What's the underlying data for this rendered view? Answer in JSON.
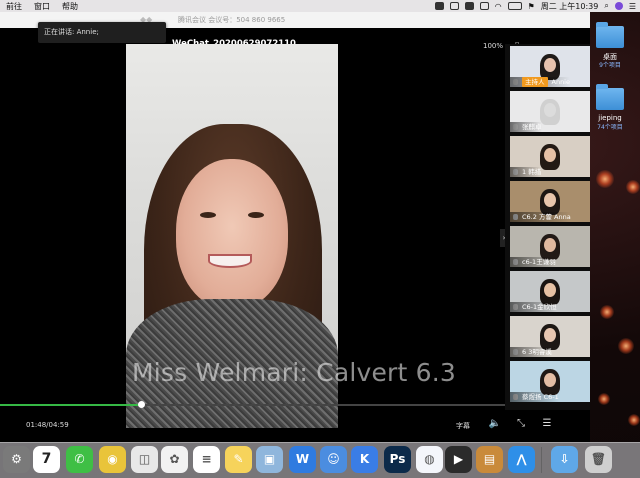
{
  "menubar": {
    "items": [
      "前往",
      "窗口",
      "帮助"
    ],
    "clock": "周二 上午10:39"
  },
  "meeting": {
    "id_text": "腾讯会议 会议号：504 860 9665",
    "speaking": "正在讲话: Annie;"
  },
  "player": {
    "title": "WeChat_20200629072110",
    "zoom": "100%",
    "caption": "Miss Welmari: Calvert 6.3",
    "time": "01:48/04:59",
    "subtitle_label": "字幕",
    "progress": 0.28
  },
  "participants": [
    {
      "name": "Annie",
      "host_tag": "主持人",
      "bg": "#dfe3ea",
      "skin": "#e7c2ae",
      "hair": "#1f1a18"
    },
    {
      "name": "张麒卓",
      "host_tag": "",
      "bg": "#e9e9ea",
      "skin": "#dcdcdc",
      "hair": "#d0d0d0"
    },
    {
      "name": "1 韩措",
      "host_tag": "",
      "bg": "#d8cfc4",
      "skin": "#e5c0a5",
      "hair": "#231a14"
    },
    {
      "name": "C6.2 方藿 Anna",
      "host_tag": "",
      "bg": "#a98e6c",
      "skin": "#e7c5ac",
      "hair": "#1d1714"
    },
    {
      "name": "c6-1王谦羽",
      "host_tag": "",
      "bg": "#b9b6ae",
      "skin": "#e0b99f",
      "hair": "#221a16"
    },
    {
      "name": "C6-1金欣恒",
      "host_tag": "",
      "bg": "#c5c8c9",
      "skin": "#e6c1a4",
      "hair": "#1a1512"
    },
    {
      "name": "6 3明睿溪",
      "host_tag": "",
      "bg": "#d9d4cd",
      "skin": "#e7c6b0",
      "hair": "#1c1714"
    },
    {
      "name": "蔡煜扬 C6-1",
      "host_tag": "",
      "bg": "#bcd6e4",
      "skin": "#e4bea4",
      "hair": "#201915"
    }
  ],
  "desktop": {
    "folders": [
      {
        "name": "桌面",
        "count": "9个项目"
      },
      {
        "name": "jieping",
        "count": "74个项目"
      }
    ]
  },
  "dock": {
    "calendar_day": "7",
    "apps": [
      {
        "name": "system-preferences",
        "color": "#7a7a7a",
        "glyph": "⚙"
      },
      {
        "name": "calendar",
        "color": "#ffffff",
        "glyph": ""
      },
      {
        "name": "wechat",
        "color": "#3fbf45",
        "glyph": "✆"
      },
      {
        "name": "chrome",
        "color": "#e9c43a",
        "glyph": "◉"
      },
      {
        "name": "screenshot",
        "color": "#e8e8e8",
        "glyph": "◫"
      },
      {
        "name": "photos",
        "color": "#f2f2f2",
        "glyph": "✿"
      },
      {
        "name": "reminders",
        "color": "#ffffff",
        "glyph": "≡"
      },
      {
        "name": "notes",
        "color": "#f6d35b",
        "glyph": "✎"
      },
      {
        "name": "preview",
        "color": "#8fb6dc",
        "glyph": "▣"
      },
      {
        "name": "wps",
        "color": "#2f7be0",
        "glyph": "W"
      },
      {
        "name": "contacts",
        "color": "#4b8de0",
        "glyph": "☺"
      },
      {
        "name": "k-app",
        "color": "#3a7de6",
        "glyph": "K"
      },
      {
        "name": "photoshop",
        "color": "#0c2a4a",
        "glyph": "Ps"
      },
      {
        "name": "tencent-meeting",
        "color": "#f4f6fb",
        "glyph": "◍"
      },
      {
        "name": "final-cut",
        "color": "#2b2b2b",
        "glyph": "▶"
      },
      {
        "name": "archive",
        "color": "#c98a3a",
        "glyph": "▤"
      },
      {
        "name": "lark",
        "color": "#2e8fe8",
        "glyph": "⋀"
      },
      {
        "name": "downloads",
        "color": "#5fa8e8",
        "glyph": "⇩"
      },
      {
        "name": "trash",
        "color": "#cfcfcf",
        "glyph": "🗑"
      }
    ]
  }
}
